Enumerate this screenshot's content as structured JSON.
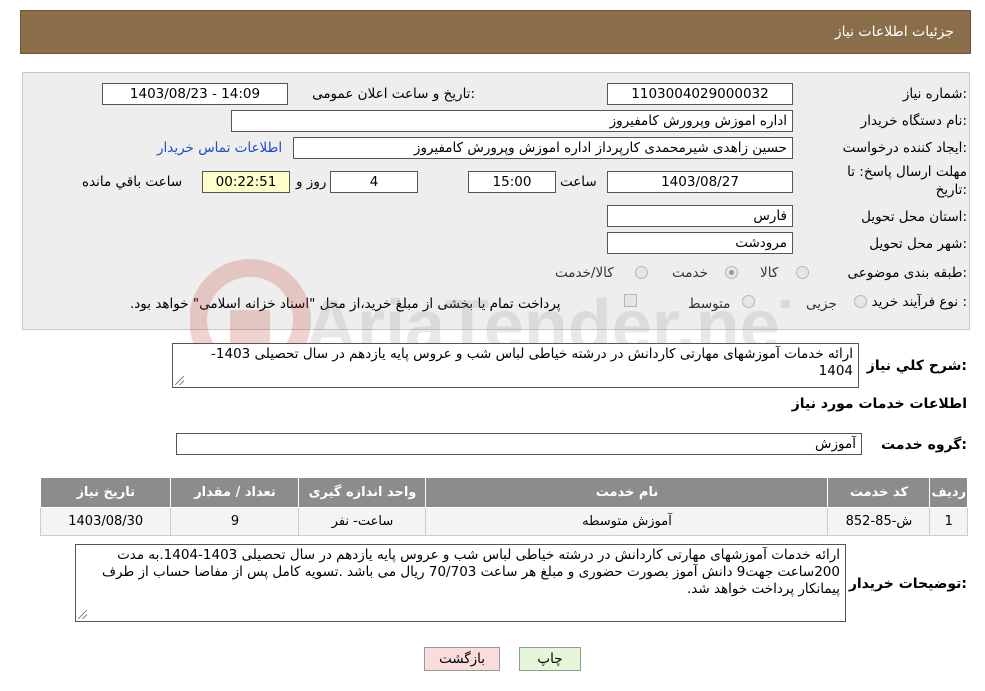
{
  "header": {
    "title": "جزئیات اطلاعات نیاز"
  },
  "form": {
    "need_number": {
      "label": "شماره نیاز:",
      "value": "1103004029000032"
    },
    "announce_datetime": {
      "label": "تاریخ و ساعت اعلان عمومی:",
      "value": "1403/08/23 - 14:09"
    },
    "buyer_org": {
      "label": "نام دستگاه خریدار:",
      "value": "اداره اموزش وپرورش کامفیروز"
    },
    "creator": {
      "label": "ایجاد کننده درخواست:",
      "value": "حسین زاهدی شیرمحمدی کارپرداز اداره اموزش وپرورش کامفیروز"
    },
    "contact_link": "اطلاعات تماس خریدار",
    "deadline": {
      "label_line1": "مهلت ارسال پاسخ: تا",
      "label_line2": "تاریخ:",
      "date": "1403/08/27",
      "time_label": "ساعت",
      "time": "15:00",
      "days": "4",
      "days_label": "روز و",
      "remaining": "00:22:51",
      "remaining_label": "ساعت باقي مانده"
    },
    "province": {
      "label": "استان محل تحویل:",
      "value": "فارس"
    },
    "city": {
      "label": "شهر محل تحویل:",
      "value": "مرودشت"
    },
    "category": {
      "label": "طبقه بندی موضوعی:",
      "options": [
        "کالا",
        "خدمت",
        "کالا/خدمت"
      ],
      "selected": "خدمت"
    },
    "purchase_type": {
      "label": "نوع فرآیند خرید :",
      "options": [
        "جزیی",
        "متوسط"
      ],
      "note": "پرداخت تمام یا بخشی از مبلغ خرید،از محل \"اسناد خزانه اسلامی\" خواهد بود."
    }
  },
  "summary": {
    "label": "شرح کلي نیاز:",
    "text": "ارائه خدمات آموزشهای مهارتی کاردانش در درشته خیاطی لباس شب و عروس  پایه یازدهم در سال تحصیلی 1403-1404"
  },
  "services": {
    "title": "اطلاعات خدمات مورد نیاز",
    "group_label": "گروه خدمت:",
    "group_value": "آموزش",
    "columns": [
      "ردیف",
      "کد خدمت",
      "نام خدمت",
      "واحد اندازه گیری",
      "تعداد / مقدار",
      "تاریخ نیاز"
    ],
    "rows": [
      [
        "1",
        "ش-85-852",
        "آموزش متوسطه",
        "ساعت- نفر",
        "9",
        "1403/08/30"
      ]
    ]
  },
  "buyer_notes": {
    "label": "توضیحات خریدار:",
    "text": "ارائه خدمات آموزشهای مهارتی کاردانش در درشته خیاطی لباس شب و عروس  پایه یازدهم در سال تحصیلی 1403-1404.به مدت 200ساعت جهت9 دانش آموز بصورت حضوری و مبلغ هر ساعت 70/703 ریال می باشد .تسویه کامل پس از مفاصا حساب از طرف پیمانکار پرداخت خواهد شد."
  },
  "buttons": {
    "print": "چاپ",
    "back": "بازگشت"
  },
  "watermark": {
    "text": "AriaTender.neT"
  }
}
